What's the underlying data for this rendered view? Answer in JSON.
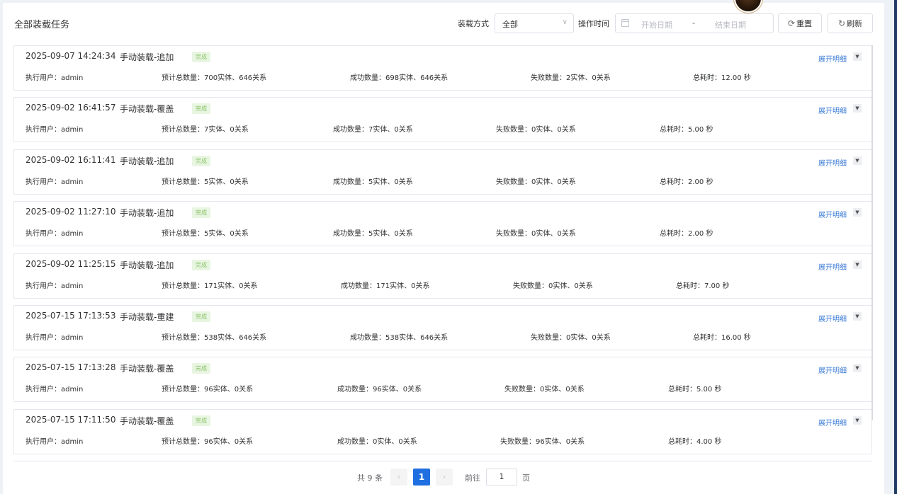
{
  "header": {
    "title": "全部装载任务",
    "load_mode_label": "装载方式",
    "load_mode_value": "全部",
    "op_time_label": "操作时间",
    "date_start_placeholder": "开始日期",
    "date_separator": "-",
    "date_end_placeholder": "结束日期",
    "reset_label": "重置",
    "refresh_label": "刷新"
  },
  "icons": {
    "select": "chevron-down-icon",
    "date": "calendar-icon",
    "reset": "reset-icon",
    "refresh": "refresh-icon",
    "expand": "caret-down-icon"
  },
  "colors": {
    "accent": "#1f6fe0",
    "link": "#3a7bd5",
    "status_bg": "#e8f5e1",
    "status_text": "#8bc46a"
  },
  "tasks": [
    {
      "time": "2025-09-07 14:24:34",
      "type": "手动装载-追加",
      "status": "完成",
      "expand": "展开明细",
      "user": "执行用户：admin",
      "expected": "预计总数量：700实体、646关系",
      "success": "成功数量：698实体、646关系",
      "failed": "失败数量：2实体、0关系",
      "duration": "总耗时：12.00 秒"
    },
    {
      "time": "2025-09-02 16:41:57",
      "type": "手动装载-覆盖",
      "status": "完成",
      "expand": "展开明细",
      "user": "执行用户：admin",
      "expected": "预计总数量：7实体、0关系",
      "success": "成功数量：7实体、0关系",
      "failed": "失败数量：0实体、0关系",
      "duration": "总耗时：5.00 秒"
    },
    {
      "time": "2025-09-02 16:11:41",
      "type": "手动装载-追加",
      "status": "完成",
      "expand": "展开明细",
      "user": "执行用户：admin",
      "expected": "预计总数量：5实体、0关系",
      "success": "成功数量：5实体、0关系",
      "failed": "失败数量：0实体、0关系",
      "duration": "总耗时：2.00 秒"
    },
    {
      "time": "2025-09-02 11:27:10",
      "type": "手动装载-追加",
      "status": "完成",
      "expand": "展开明细",
      "user": "执行用户：admin",
      "expected": "预计总数量：5实体、0关系",
      "success": "成功数量：5实体、0关系",
      "failed": "失败数量：0实体、0关系",
      "duration": "总耗时：2.00 秒"
    },
    {
      "time": "2025-09-02 11:25:15",
      "type": "手动装载-追加",
      "status": "完成",
      "expand": "展开明细",
      "user": "执行用户：admin",
      "expected": "预计总数量：171实体、0关系",
      "success": "成功数量：171实体、0关系",
      "failed": "失败数量：0实体、0关系",
      "duration": "总耗时：7.00 秒"
    },
    {
      "time": "2025-07-15 17:13:53",
      "type": "手动装载-重建",
      "status": "完成",
      "expand": "展开明细",
      "user": "执行用户：admin",
      "expected": "预计总数量：538实体、646关系",
      "success": "成功数量：538实体、646关系",
      "failed": "失败数量：0实体、0关系",
      "duration": "总耗时：16.00 秒"
    },
    {
      "time": "2025-07-15 17:13:28",
      "type": "手动装载-覆盖",
      "status": "完成",
      "expand": "展开明细",
      "user": "执行用户：admin",
      "expected": "预计总数量：96实体、0关系",
      "success": "成功数量：96实体、0关系",
      "failed": "失败数量：0实体、0关系",
      "duration": "总耗时：5.00 秒"
    },
    {
      "time": "2025-07-15 17:11:50",
      "type": "手动装载-覆盖",
      "status": "完成",
      "expand": "展开明细",
      "user": "执行用户：admin",
      "expected": "预计总数量：96实体、0关系",
      "success": "成功数量：0实体、0关系",
      "failed": "失败数量：96实体、0关系",
      "duration": "总耗时：4.00 秒"
    }
  ],
  "pagination": {
    "total": "共 9 条",
    "prev": "‹",
    "current": "1",
    "next": "›",
    "goto_label": "前往",
    "goto_value": "1",
    "page_suffix": "页"
  }
}
